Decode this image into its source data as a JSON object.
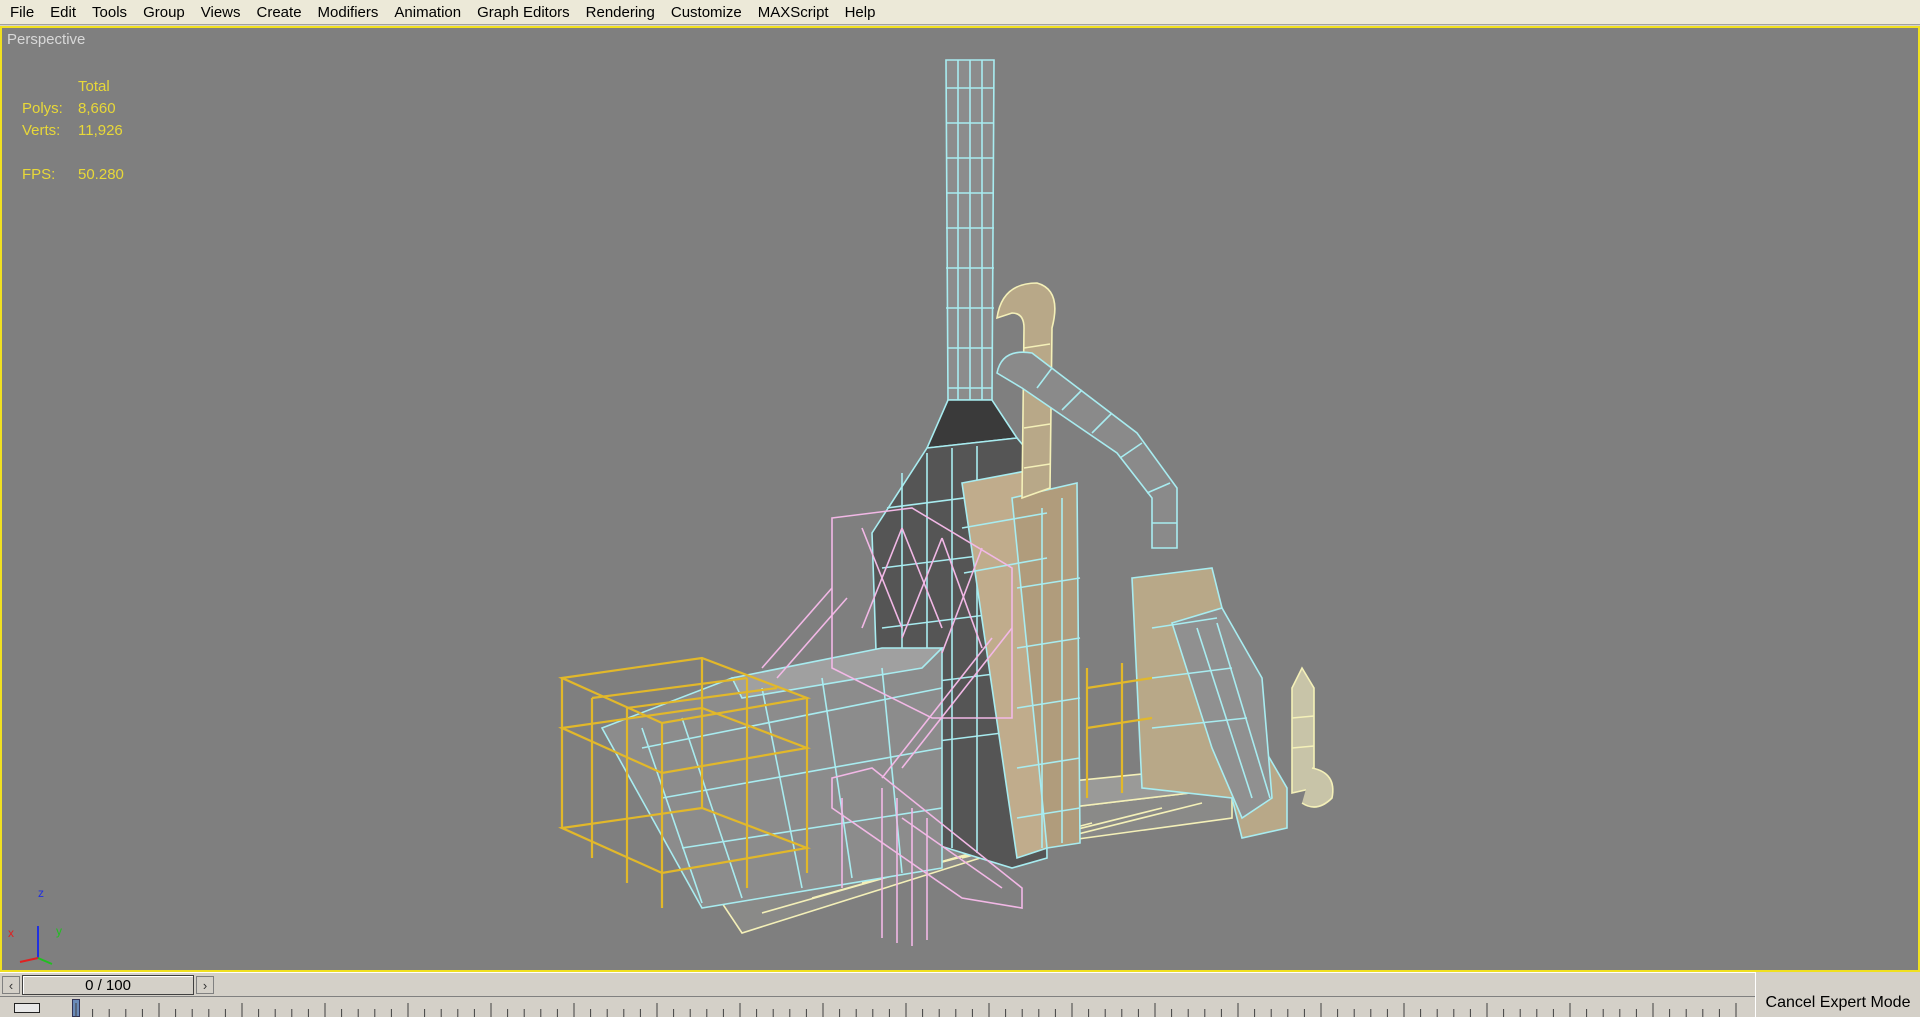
{
  "menu": [
    "File",
    "Edit",
    "Tools",
    "Group",
    "Views",
    "Create",
    "Modifiers",
    "Animation",
    "Graph Editors",
    "Rendering",
    "Customize",
    "MAXScript",
    "Help"
  ],
  "viewport": {
    "label": "Perspective",
    "stats": {
      "header": "Total",
      "polys_label": "Polys:",
      "polys_value": "8,660",
      "verts_label": "Verts:",
      "verts_value": "11,926",
      "fps_label": "FPS:",
      "fps_value": "50.280"
    },
    "axis": {
      "z": "z",
      "x": "x",
      "y": "y"
    }
  },
  "timeline": {
    "frame_text": "0 / 100",
    "prev_icon": "chevron-left-icon",
    "next_icon": "chevron-right-icon"
  },
  "cancel_expert": "Cancel Expert Mode",
  "colors": {
    "viewport_bg": "#7f7f7f",
    "active_border": "#f0e020",
    "stats_text": "#e8d838",
    "wire_cyan": "#a8ecf0",
    "wire_pink": "#f2b8e6",
    "wire_yellow": "#e2b82a",
    "wire_cream": "#f4f0b8",
    "surface_tan": "#b8a888"
  }
}
